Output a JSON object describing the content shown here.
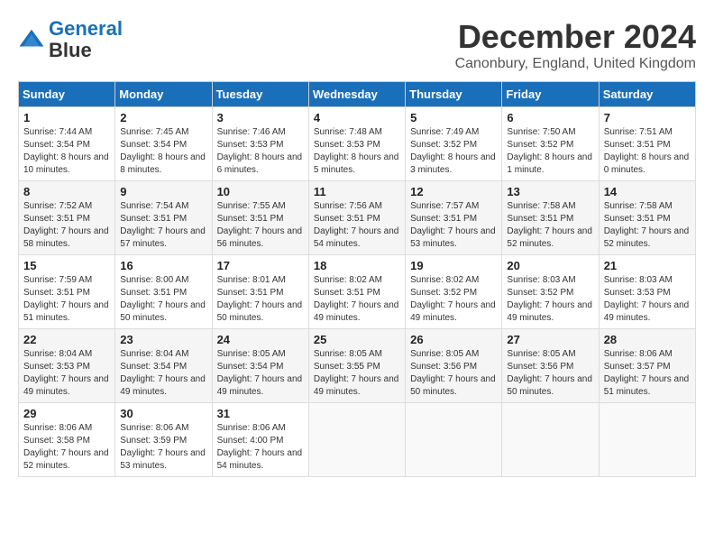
{
  "header": {
    "logo_line1": "General",
    "logo_line2": "Blue",
    "month": "December 2024",
    "location": "Canonbury, England, United Kingdom"
  },
  "weekdays": [
    "Sunday",
    "Monday",
    "Tuesday",
    "Wednesday",
    "Thursday",
    "Friday",
    "Saturday"
  ],
  "weeks": [
    [
      {
        "day": 1,
        "sunrise": "7:44 AM",
        "sunset": "3:54 PM",
        "daylight": "8 hours and 10 minutes."
      },
      {
        "day": 2,
        "sunrise": "7:45 AM",
        "sunset": "3:54 PM",
        "daylight": "8 hours and 8 minutes."
      },
      {
        "day": 3,
        "sunrise": "7:46 AM",
        "sunset": "3:53 PM",
        "daylight": "8 hours and 6 minutes."
      },
      {
        "day": 4,
        "sunrise": "7:48 AM",
        "sunset": "3:53 PM",
        "daylight": "8 hours and 5 minutes."
      },
      {
        "day": 5,
        "sunrise": "7:49 AM",
        "sunset": "3:52 PM",
        "daylight": "8 hours and 3 minutes."
      },
      {
        "day": 6,
        "sunrise": "7:50 AM",
        "sunset": "3:52 PM",
        "daylight": "8 hours and 1 minute."
      },
      {
        "day": 7,
        "sunrise": "7:51 AM",
        "sunset": "3:51 PM",
        "daylight": "8 hours and 0 minutes."
      }
    ],
    [
      {
        "day": 8,
        "sunrise": "7:52 AM",
        "sunset": "3:51 PM",
        "daylight": "7 hours and 58 minutes."
      },
      {
        "day": 9,
        "sunrise": "7:54 AM",
        "sunset": "3:51 PM",
        "daylight": "7 hours and 57 minutes."
      },
      {
        "day": 10,
        "sunrise": "7:55 AM",
        "sunset": "3:51 PM",
        "daylight": "7 hours and 56 minutes."
      },
      {
        "day": 11,
        "sunrise": "7:56 AM",
        "sunset": "3:51 PM",
        "daylight": "7 hours and 54 minutes."
      },
      {
        "day": 12,
        "sunrise": "7:57 AM",
        "sunset": "3:51 PM",
        "daylight": "7 hours and 53 minutes."
      },
      {
        "day": 13,
        "sunrise": "7:58 AM",
        "sunset": "3:51 PM",
        "daylight": "7 hours and 52 minutes."
      },
      {
        "day": 14,
        "sunrise": "7:58 AM",
        "sunset": "3:51 PM",
        "daylight": "7 hours and 52 minutes."
      }
    ],
    [
      {
        "day": 15,
        "sunrise": "7:59 AM",
        "sunset": "3:51 PM",
        "daylight": "7 hours and 51 minutes."
      },
      {
        "day": 16,
        "sunrise": "8:00 AM",
        "sunset": "3:51 PM",
        "daylight": "7 hours and 50 minutes."
      },
      {
        "day": 17,
        "sunrise": "8:01 AM",
        "sunset": "3:51 PM",
        "daylight": "7 hours and 50 minutes."
      },
      {
        "day": 18,
        "sunrise": "8:02 AM",
        "sunset": "3:51 PM",
        "daylight": "7 hours and 49 minutes."
      },
      {
        "day": 19,
        "sunrise": "8:02 AM",
        "sunset": "3:52 PM",
        "daylight": "7 hours and 49 minutes."
      },
      {
        "day": 20,
        "sunrise": "8:03 AM",
        "sunset": "3:52 PM",
        "daylight": "7 hours and 49 minutes."
      },
      {
        "day": 21,
        "sunrise": "8:03 AM",
        "sunset": "3:53 PM",
        "daylight": "7 hours and 49 minutes."
      }
    ],
    [
      {
        "day": 22,
        "sunrise": "8:04 AM",
        "sunset": "3:53 PM",
        "daylight": "7 hours and 49 minutes."
      },
      {
        "day": 23,
        "sunrise": "8:04 AM",
        "sunset": "3:54 PM",
        "daylight": "7 hours and 49 minutes."
      },
      {
        "day": 24,
        "sunrise": "8:05 AM",
        "sunset": "3:54 PM",
        "daylight": "7 hours and 49 minutes."
      },
      {
        "day": 25,
        "sunrise": "8:05 AM",
        "sunset": "3:55 PM",
        "daylight": "7 hours and 49 minutes."
      },
      {
        "day": 26,
        "sunrise": "8:05 AM",
        "sunset": "3:56 PM",
        "daylight": "7 hours and 50 minutes."
      },
      {
        "day": 27,
        "sunrise": "8:05 AM",
        "sunset": "3:56 PM",
        "daylight": "7 hours and 50 minutes."
      },
      {
        "day": 28,
        "sunrise": "8:06 AM",
        "sunset": "3:57 PM",
        "daylight": "7 hours and 51 minutes."
      }
    ],
    [
      {
        "day": 29,
        "sunrise": "8:06 AM",
        "sunset": "3:58 PM",
        "daylight": "7 hours and 52 minutes."
      },
      {
        "day": 30,
        "sunrise": "8:06 AM",
        "sunset": "3:59 PM",
        "daylight": "7 hours and 53 minutes."
      },
      {
        "day": 31,
        "sunrise": "8:06 AM",
        "sunset": "4:00 PM",
        "daylight": "7 hours and 54 minutes."
      },
      null,
      null,
      null,
      null
    ]
  ]
}
